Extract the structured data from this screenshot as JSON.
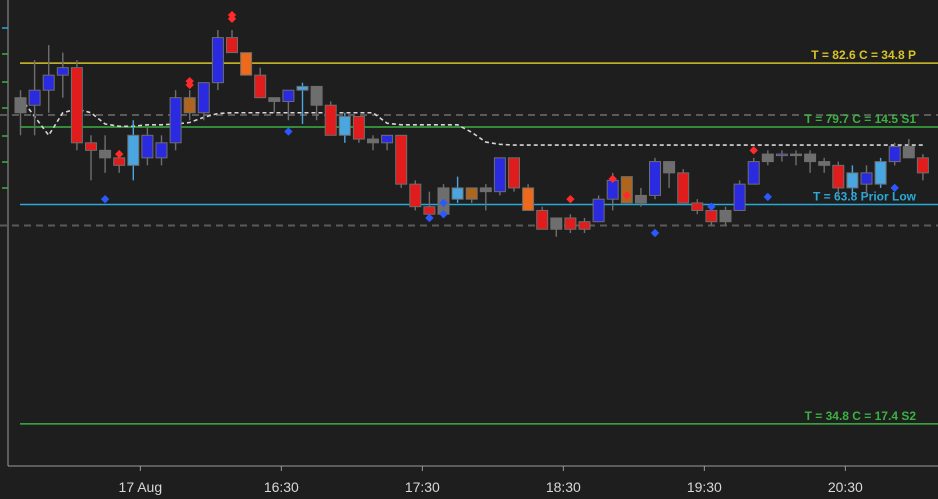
{
  "colors": {
    "background": "#1e1e1e",
    "axis": "#9a9a9a",
    "text": "#d8d8d8",
    "pivot_p": "#d8c32a",
    "pivot_s": "#3cb043",
    "prior_low": "#29a9d8",
    "bull": "#2a2ae0",
    "bear": "#e01c1c",
    "neutral": "#6e6e6e",
    "bear_light": "#ee6a1a",
    "bull_light": "#4aa6e0",
    "orange_body": "#b0651e",
    "dashed_ma": "#d6d6d6",
    "dashed_gray": "#5a5a5a",
    "signal_red": "#ff2a2a",
    "signal_blue": "#2a5aff"
  },
  "chart_data": {
    "type": "candlestick",
    "ylim": [
      29,
      91
    ],
    "x_ticks": [
      {
        "label": "17 Aug",
        "index": 8.5
      },
      {
        "label": "16:30",
        "index": 18.5
      },
      {
        "label": "17:30",
        "index": 28.5
      },
      {
        "label": "18:30",
        "index": 38.5
      },
      {
        "label": "19:30",
        "index": 48.5
      },
      {
        "label": "20:30",
        "index": 58.5
      }
    ],
    "levels": [
      {
        "value": 82.6,
        "text": "T = 82.6   C = 34.8  P",
        "color": "pivot_p"
      },
      {
        "value": 74.1,
        "text": "T = 79.7   C = 14.5  S1",
        "color": "pivot_s"
      },
      {
        "value": 63.8,
        "text": "T = 63.8   Prior Low",
        "color": "prior_low"
      },
      {
        "value": 34.6,
        "text": "T = 34.8   C = 17.4  S2",
        "color": "pivot_s"
      }
    ],
    "gray_dashed_levels": [
      75.7,
      61.0
    ],
    "ma_line": [
      [
        0,
        78
      ],
      [
        2,
        73
      ],
      [
        3,
        76
      ],
      [
        4,
        76.5
      ],
      [
        5,
        76
      ],
      [
        6,
        74.5
      ],
      [
        7,
        74.2
      ],
      [
        8,
        74.2
      ],
      [
        9,
        74.4
      ],
      [
        10,
        74.4
      ],
      [
        11,
        74.5
      ],
      [
        12,
        74.7
      ],
      [
        13,
        75.4
      ],
      [
        14,
        75.9
      ],
      [
        15,
        76
      ],
      [
        16,
        76
      ],
      [
        17,
        76
      ],
      [
        18,
        76
      ],
      [
        19,
        76
      ],
      [
        20,
        76
      ],
      [
        21,
        76
      ],
      [
        22,
        76
      ],
      [
        23,
        76
      ],
      [
        24,
        76
      ],
      [
        25,
        76
      ],
      [
        26,
        74.6
      ],
      [
        27,
        74.4
      ],
      [
        28,
        74.4
      ],
      [
        29,
        74.4
      ],
      [
        30,
        74.4
      ],
      [
        31,
        74.4
      ],
      [
        32,
        73.4
      ],
      [
        33,
        72.1
      ],
      [
        34,
        71.8
      ],
      [
        35,
        71.7
      ],
      [
        36,
        71.7
      ],
      [
        37,
        71.7
      ],
      [
        38,
        71.7
      ],
      [
        39,
        71.7
      ],
      [
        40,
        71.7
      ],
      [
        41,
        71.7
      ],
      [
        42,
        71.7
      ],
      [
        43,
        71.7
      ],
      [
        44,
        71.7
      ],
      [
        45,
        71.7
      ],
      [
        46,
        71.7
      ],
      [
        47,
        71.7
      ],
      [
        48,
        71.7
      ],
      [
        49,
        71.7
      ],
      [
        50,
        71.7
      ],
      [
        51,
        71.7
      ],
      [
        52,
        71.7
      ],
      [
        53,
        71.7
      ],
      [
        54,
        71.7
      ],
      [
        55,
        71.7
      ],
      [
        56,
        71.7
      ],
      [
        57,
        71.7
      ],
      [
        58,
        71.7
      ],
      [
        59,
        71.7
      ],
      [
        60,
        71.7
      ],
      [
        61,
        71.7
      ],
      [
        62,
        71.7
      ],
      [
        63,
        71.7
      ],
      [
        64,
        71.7
      ]
    ],
    "candles": [
      {
        "o": 76,
        "h": 79,
        "l": 73,
        "c": 78,
        "k": "neutral"
      },
      {
        "o": 77,
        "h": 83,
        "l": 73,
        "c": 79,
        "k": "bull"
      },
      {
        "o": 79,
        "h": 85,
        "l": 76,
        "c": 81,
        "k": "bull"
      },
      {
        "o": 81,
        "h": 84,
        "l": 78,
        "c": 82,
        "k": "bull"
      },
      {
        "o": 82,
        "h": 83,
        "l": 71,
        "c": 72,
        "k": "bear"
      },
      {
        "o": 72,
        "h": 73,
        "l": 67,
        "c": 71,
        "k": "bear"
      },
      {
        "o": 71,
        "h": 73,
        "l": 68,
        "c": 70,
        "k": "neutral"
      },
      {
        "o": 70,
        "h": 71,
        "l": 68,
        "c": 69,
        "k": "bear"
      },
      {
        "o": 69,
        "h": 75,
        "l": 67,
        "c": 73,
        "k": "bull_light"
      },
      {
        "o": 73,
        "h": 74,
        "l": 69,
        "c": 70,
        "k": "bull"
      },
      {
        "o": 70,
        "h": 73,
        "l": 69,
        "c": 72,
        "k": "bull"
      },
      {
        "o": 72,
        "h": 79,
        "l": 71,
        "c": 78,
        "k": "bull"
      },
      {
        "o": 78,
        "h": 79,
        "l": 75,
        "c": 76,
        "k": "orange_body"
      },
      {
        "o": 76,
        "h": 80,
        "l": 75,
        "c": 80,
        "k": "bull"
      },
      {
        "o": 80,
        "h": 87,
        "l": 79,
        "c": 86,
        "k": "bull"
      },
      {
        "o": 86,
        "h": 87,
        "l": 84,
        "c": 84,
        "k": "bear"
      },
      {
        "o": 84,
        "h": 84,
        "l": 81,
        "c": 81,
        "k": "bear_light"
      },
      {
        "o": 81,
        "h": 82,
        "l": 78,
        "c": 78,
        "k": "bear"
      },
      {
        "o": 78,
        "h": 78,
        "l": 76,
        "c": 77.5,
        "k": "neutral"
      },
      {
        "o": 77.5,
        "h": 79,
        "l": 75,
        "c": 79,
        "k": "bull"
      },
      {
        "o": 79,
        "h": 80,
        "l": 74.5,
        "c": 79.5,
        "k": "bull_light"
      },
      {
        "o": 79.5,
        "h": 79.5,
        "l": 75,
        "c": 77,
        "k": "neutral"
      },
      {
        "o": 77,
        "h": 77.5,
        "l": 73,
        "c": 73,
        "k": "bear"
      },
      {
        "o": 73,
        "h": 76,
        "l": 72,
        "c": 75.5,
        "k": "bull_light"
      },
      {
        "o": 75.5,
        "h": 75.5,
        "l": 72,
        "c": 72.5,
        "k": "bear"
      },
      {
        "o": 72.5,
        "h": 73,
        "l": 71,
        "c": 72,
        "k": "neutral"
      },
      {
        "o": 72,
        "h": 73,
        "l": 71,
        "c": 73,
        "k": "bull"
      },
      {
        "o": 73,
        "h": 73,
        "l": 66,
        "c": 66.5,
        "k": "bear"
      },
      {
        "o": 66.5,
        "h": 67,
        "l": 63,
        "c": 63.5,
        "k": "bear"
      },
      {
        "o": 63.5,
        "h": 65.5,
        "l": 62.5,
        "c": 62.5,
        "k": "bear"
      },
      {
        "o": 62.5,
        "h": 66.5,
        "l": 62,
        "c": 66,
        "k": "neutral"
      },
      {
        "o": 66,
        "h": 67.5,
        "l": 64,
        "c": 64.5,
        "k": "bull_light"
      },
      {
        "o": 64.5,
        "h": 66,
        "l": 64,
        "c": 66,
        "k": "orange_body"
      },
      {
        "o": 66,
        "h": 66.5,
        "l": 63,
        "c": 65.5,
        "k": "neutral"
      },
      {
        "o": 65.5,
        "h": 70,
        "l": 65,
        "c": 70,
        "k": "bull"
      },
      {
        "o": 70,
        "h": 70,
        "l": 65.5,
        "c": 66,
        "k": "bear"
      },
      {
        "o": 66,
        "h": 66.5,
        "l": 63,
        "c": 63,
        "k": "bear_light"
      },
      {
        "o": 63,
        "h": 63.5,
        "l": 60.5,
        "c": 60.5,
        "k": "bear"
      },
      {
        "o": 60.5,
        "h": 62,
        "l": 59.5,
        "c": 62,
        "k": "neutral"
      },
      {
        "o": 62,
        "h": 62.5,
        "l": 60,
        "c": 60.5,
        "k": "bear"
      },
      {
        "o": 60.5,
        "h": 62,
        "l": 60,
        "c": 61.5,
        "k": "bear"
      },
      {
        "o": 61.5,
        "h": 65,
        "l": 61.5,
        "c": 64.5,
        "k": "bull"
      },
      {
        "o": 64.5,
        "h": 68,
        "l": 63,
        "c": 67,
        "k": "bull"
      },
      {
        "o": 67.5,
        "h": 67.5,
        "l": 64,
        "c": 64,
        "k": "orange_body"
      },
      {
        "o": 64,
        "h": 66,
        "l": 63.5,
        "c": 65,
        "k": "neutral"
      },
      {
        "o": 65,
        "h": 70,
        "l": 64.5,
        "c": 69.5,
        "k": "bull"
      },
      {
        "o": 69.5,
        "h": 69.5,
        "l": 66,
        "c": 68,
        "k": "neutral"
      },
      {
        "o": 68,
        "h": 68.5,
        "l": 64,
        "c": 64,
        "k": "bear"
      },
      {
        "o": 64,
        "h": 64.5,
        "l": 62.5,
        "c": 63,
        "k": "bear"
      },
      {
        "o": 63,
        "h": 63.5,
        "l": 61,
        "c": 61.5,
        "k": "bear"
      },
      {
        "o": 61.5,
        "h": 63.5,
        "l": 61,
        "c": 63,
        "k": "neutral"
      },
      {
        "o": 63,
        "h": 67,
        "l": 63,
        "c": 66.5,
        "k": "bull"
      },
      {
        "o": 66.5,
        "h": 70,
        "l": 66.5,
        "c": 69.5,
        "k": "bull"
      },
      {
        "o": 69.5,
        "h": 71,
        "l": 69,
        "c": 70.5,
        "k": "neutral"
      },
      {
        "o": 70.5,
        "h": 71,
        "l": 69.5,
        "c": 70.5,
        "k": "bull"
      },
      {
        "o": 70.5,
        "h": 71,
        "l": 69,
        "c": 70.5,
        "k": "neutral"
      },
      {
        "o": 70.5,
        "h": 71,
        "l": 68,
        "c": 69.5,
        "k": "neutral"
      },
      {
        "o": 69.5,
        "h": 70,
        "l": 68,
        "c": 69,
        "k": "neutral"
      },
      {
        "o": 69,
        "h": 69.5,
        "l": 65,
        "c": 66,
        "k": "bear"
      },
      {
        "o": 66,
        "h": 69,
        "l": 65,
        "c": 68,
        "k": "bull_light"
      },
      {
        "o": 68,
        "h": 69,
        "l": 65,
        "c": 66.5,
        "k": "bull"
      },
      {
        "o": 66.5,
        "h": 70,
        "l": 66,
        "c": 69.5,
        "k": "bull_light"
      },
      {
        "o": 69.5,
        "h": 72,
        "l": 69,
        "c": 71.5,
        "k": "bull"
      },
      {
        "o": 71.5,
        "h": 72.5,
        "l": 70,
        "c": 70,
        "k": "neutral"
      },
      {
        "o": 70,
        "h": 70.5,
        "l": 67,
        "c": 68,
        "k": "bear"
      }
    ],
    "signals": [
      {
        "i": 7,
        "y": 70.5,
        "k": "signal_red"
      },
      {
        "i": 6,
        "y": 64.5,
        "k": "signal_blue"
      },
      {
        "i": 12,
        "y": 79.7,
        "k": "signal_red"
      },
      {
        "i": 12,
        "y": 80.2,
        "k": "signal_red"
      },
      {
        "i": 15,
        "y": 88.5,
        "k": "signal_red"
      },
      {
        "i": 15,
        "y": 89.0,
        "k": "signal_red"
      },
      {
        "i": 19,
        "y": 73.5,
        "k": "signal_blue"
      },
      {
        "i": 30,
        "y": 64.0,
        "k": "signal_blue"
      },
      {
        "i": 30,
        "y": 62.5,
        "k": "signal_blue"
      },
      {
        "i": 29,
        "y": 62.0,
        "k": "signal_blue"
      },
      {
        "i": 39,
        "y": 64.5,
        "k": "signal_red"
      },
      {
        "i": 42,
        "y": 67.2,
        "k": "signal_red"
      },
      {
        "i": 43,
        "y": 65.0,
        "k": "signal_red"
      },
      {
        "i": 45,
        "y": 60.0,
        "k": "signal_blue"
      },
      {
        "i": 49,
        "y": 63.5,
        "k": "signal_blue"
      },
      {
        "i": 52,
        "y": 71.0,
        "k": "signal_red"
      },
      {
        "i": 53,
        "y": 64.8,
        "k": "signal_blue"
      },
      {
        "i": 62,
        "y": 66.0,
        "k": "signal_blue"
      }
    ]
  }
}
